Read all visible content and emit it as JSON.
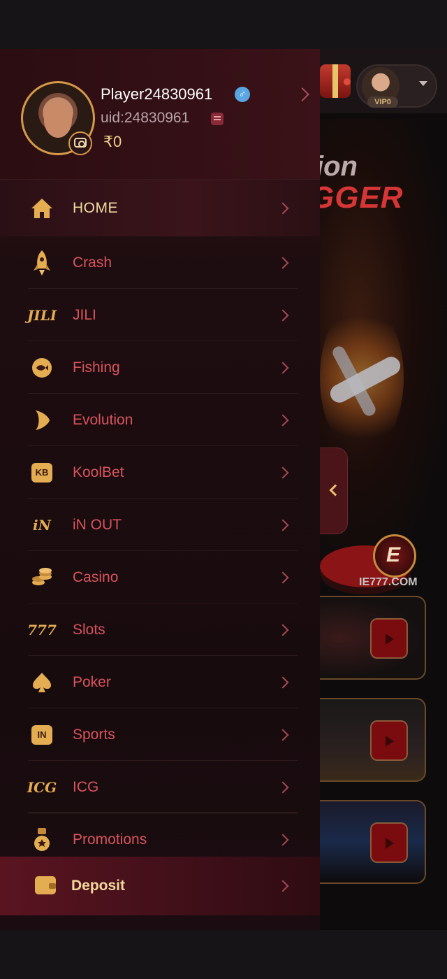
{
  "profile": {
    "player_name": "Player24830961",
    "gender_symbol": "♂",
    "uid": "uid:24830961",
    "balance": "₹0"
  },
  "background": {
    "banner_line1": "ion",
    "banner_line2": "GGER",
    "vip_label": "VIP0",
    "site_name": "IE777.COM",
    "logo_letter": "E"
  },
  "menu": {
    "items": [
      {
        "label": "HOME",
        "icon": "home-icon"
      },
      {
        "label": "Crash",
        "icon": "rocket-icon"
      },
      {
        "label": "JILI",
        "icon": "jili-logo-icon",
        "icon_text": "JILI"
      },
      {
        "label": "Fishing",
        "icon": "fish-icon"
      },
      {
        "label": "Evolution",
        "icon": "evolution-logo-icon"
      },
      {
        "label": "KoolBet",
        "icon": "koolbet-logo-icon",
        "icon_text": "KB"
      },
      {
        "label": "iN OUT",
        "icon": "inout-logo-icon",
        "icon_text": "iN"
      },
      {
        "label": "Casino",
        "icon": "coins-icon"
      },
      {
        "label": "Slots",
        "icon": "slots-777-icon",
        "icon_text": "777"
      },
      {
        "label": "Poker",
        "icon": "spade-icon"
      },
      {
        "label": "Sports",
        "icon": "sports-logo-icon",
        "icon_text": "IN"
      },
      {
        "label": "ICG",
        "icon": "icg-logo-icon",
        "icon_text": "ICG"
      },
      {
        "label": "Promotions",
        "icon": "medal-icon"
      }
    ],
    "deposit_label": "Deposit"
  },
  "colors": {
    "accent_gold": "#e4ad52",
    "menu_text": "#d8545e",
    "drawer_bg": "#1e0d10"
  }
}
